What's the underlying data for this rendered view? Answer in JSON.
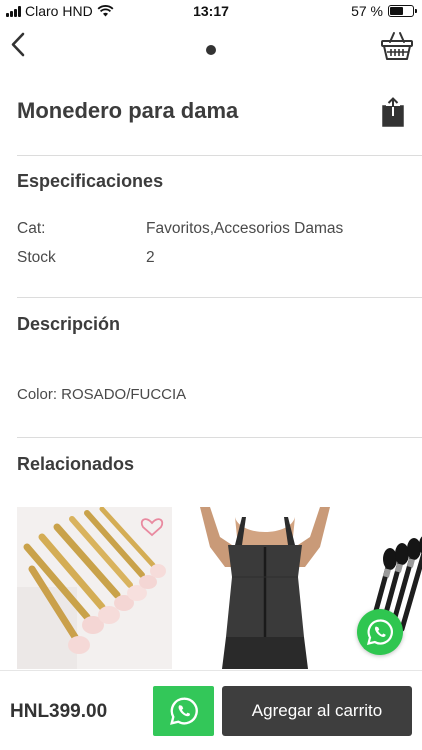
{
  "status_bar": {
    "carrier": "Claro HND",
    "time": "13:17",
    "battery_label": "57 %",
    "battery_level": 0.57
  },
  "nav": {
    "back_icon": "chevron-left-icon",
    "cart_icon": "basket-icon"
  },
  "product": {
    "title": "Monedero para dama",
    "share_icon": "share-icon"
  },
  "specs": {
    "heading": "Especificaciones",
    "rows": [
      {
        "label": "Cat:",
        "value": "Favoritos,Accesorios Damas"
      },
      {
        "label": "Stock",
        "value": "2"
      }
    ]
  },
  "description": {
    "heading": "Descripción",
    "text": "Color: ROSADO/FUCCIA"
  },
  "related": {
    "heading": "Relacionados",
    "items": [
      "makeup-brushes-gold",
      "waist-trainer-vest",
      "makeup-brushes-black"
    ]
  },
  "bottom_bar": {
    "price": "HNL399.00",
    "add_to_cart_label": "Agregar al carrito",
    "whatsapp_icon": "whatsapp-icon"
  },
  "colors": {
    "whatsapp_green": "#33c759",
    "cart_button": "#3e3e3e"
  }
}
